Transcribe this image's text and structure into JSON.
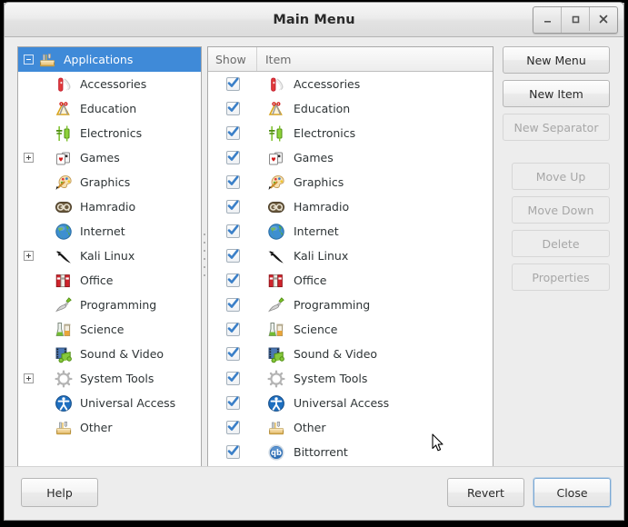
{
  "window": {
    "title": "Main Menu",
    "controls": [
      {
        "name": "minimize",
        "glyph": "_"
      },
      {
        "name": "maximize",
        "glyph": "□"
      },
      {
        "name": "close",
        "glyph": "✕"
      }
    ]
  },
  "tree": {
    "root": {
      "label": "Applications",
      "icon": "other-applications-icon",
      "expander": "minus",
      "selected": true
    },
    "items": [
      {
        "label": "Accessories",
        "icon": "accessories-icon",
        "expander": "none"
      },
      {
        "label": "Education",
        "icon": "education-icon",
        "expander": "none"
      },
      {
        "label": "Electronics",
        "icon": "electronics-icon",
        "expander": "none"
      },
      {
        "label": "Games",
        "icon": "games-icon",
        "expander": "plus"
      },
      {
        "label": "Graphics",
        "icon": "graphics-icon",
        "expander": "none"
      },
      {
        "label": "Hamradio",
        "icon": "hamradio-icon",
        "expander": "none"
      },
      {
        "label": "Internet",
        "icon": "internet-icon",
        "expander": "none"
      },
      {
        "label": "Kali Linux",
        "icon": "kali-linux-icon",
        "expander": "plus"
      },
      {
        "label": "Office",
        "icon": "office-icon",
        "expander": "none"
      },
      {
        "label": "Programming",
        "icon": "programming-icon",
        "expander": "none"
      },
      {
        "label": "Science",
        "icon": "science-icon",
        "expander": "none"
      },
      {
        "label": "Sound & Video",
        "icon": "sound-video-icon",
        "expander": "none"
      },
      {
        "label": "System Tools",
        "icon": "system-tools-icon",
        "expander": "plus"
      },
      {
        "label": "Universal Access",
        "icon": "universal-access-icon",
        "expander": "none"
      },
      {
        "label": "Other",
        "icon": "other-applications-icon",
        "expander": "none"
      }
    ]
  },
  "list": {
    "columns": {
      "show": "Show",
      "item": "Item"
    },
    "rows": [
      {
        "label": "Accessories",
        "icon": "accessories-icon",
        "checked": true
      },
      {
        "label": "Education",
        "icon": "education-icon",
        "checked": true
      },
      {
        "label": "Electronics",
        "icon": "electronics-icon",
        "checked": true
      },
      {
        "label": "Games",
        "icon": "games-icon",
        "checked": true
      },
      {
        "label": "Graphics",
        "icon": "graphics-icon",
        "checked": true
      },
      {
        "label": "Hamradio",
        "icon": "hamradio-icon",
        "checked": true
      },
      {
        "label": "Internet",
        "icon": "internet-icon",
        "checked": true
      },
      {
        "label": "Kali Linux",
        "icon": "kali-linux-icon",
        "checked": true
      },
      {
        "label": "Office",
        "icon": "office-icon",
        "checked": true
      },
      {
        "label": "Programming",
        "icon": "programming-icon",
        "checked": true
      },
      {
        "label": "Science",
        "icon": "science-icon",
        "checked": true
      },
      {
        "label": "Sound & Video",
        "icon": "sound-video-icon",
        "checked": true
      },
      {
        "label": "System Tools",
        "icon": "system-tools-icon",
        "checked": true
      },
      {
        "label": "Universal Access",
        "icon": "universal-access-icon",
        "checked": true
      },
      {
        "label": "Other",
        "icon": "other-applications-icon",
        "checked": true
      },
      {
        "label": "Bittorrent",
        "icon": "bittorrent-icon",
        "checked": true
      }
    ]
  },
  "side_buttons": [
    {
      "label": "New Menu",
      "enabled": true
    },
    {
      "label": "New Item",
      "enabled": true
    },
    {
      "label": "New Separator",
      "enabled": false
    },
    {
      "label": "Move Up",
      "enabled": false,
      "narrow": true
    },
    {
      "label": "Move Down",
      "enabled": false,
      "narrow": true
    },
    {
      "label": "Delete",
      "enabled": false,
      "narrow": true
    },
    {
      "label": "Properties",
      "enabled": false,
      "narrow": true
    }
  ],
  "bottom_bar": {
    "help": "Help",
    "revert": "Revert",
    "close": "Close"
  },
  "colors": {
    "selection_blue": "#3f8ad8",
    "window_bg": "#ededed",
    "panel_bg": "#ffffff",
    "check_blue": "#3a7fc8",
    "focus_border": "#7aa9d6"
  }
}
